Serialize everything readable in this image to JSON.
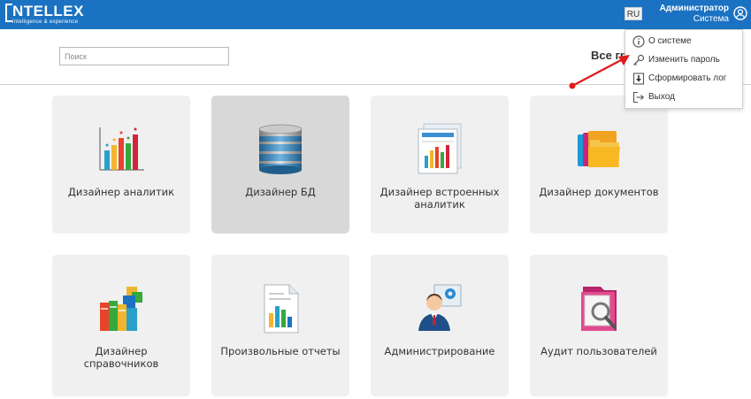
{
  "header": {
    "logo_text": "NTELLEX",
    "logo_tagline": "intelligence & experience",
    "lang": "RU",
    "user_name": "Администратор",
    "user_role": "Система",
    "accent_color": "#1b72c2"
  },
  "search": {
    "placeholder": "Поиск"
  },
  "group_label": "Все гр",
  "tiles": [
    {
      "label": "Дизайнер аналитик",
      "icon": "bar-chart-icon"
    },
    {
      "label": "Дизайнер БД",
      "icon": "database-icon",
      "active": true
    },
    {
      "label": "Дизайнер встроенных аналитик",
      "icon": "report-chart-icon"
    },
    {
      "label": "Дизайнер документов",
      "icon": "folders-icon"
    },
    {
      "label": "Дизайнер справочников",
      "icon": "books-icon"
    },
    {
      "label": "Произвольные отчеты",
      "icon": "document-chart-icon"
    },
    {
      "label": "Администрирование",
      "icon": "admin-user-icon"
    },
    {
      "label": "Аудит пользователей",
      "icon": "audit-folder-icon"
    }
  ],
  "user_menu": {
    "items": [
      {
        "label": "О системе",
        "icon": "info-icon"
      },
      {
        "label": "Изменить пароль",
        "icon": "key-icon"
      },
      {
        "label": "Сформировать лог",
        "icon": "download-log-icon"
      },
      {
        "label": "Выход",
        "icon": "logout-icon"
      }
    ]
  }
}
